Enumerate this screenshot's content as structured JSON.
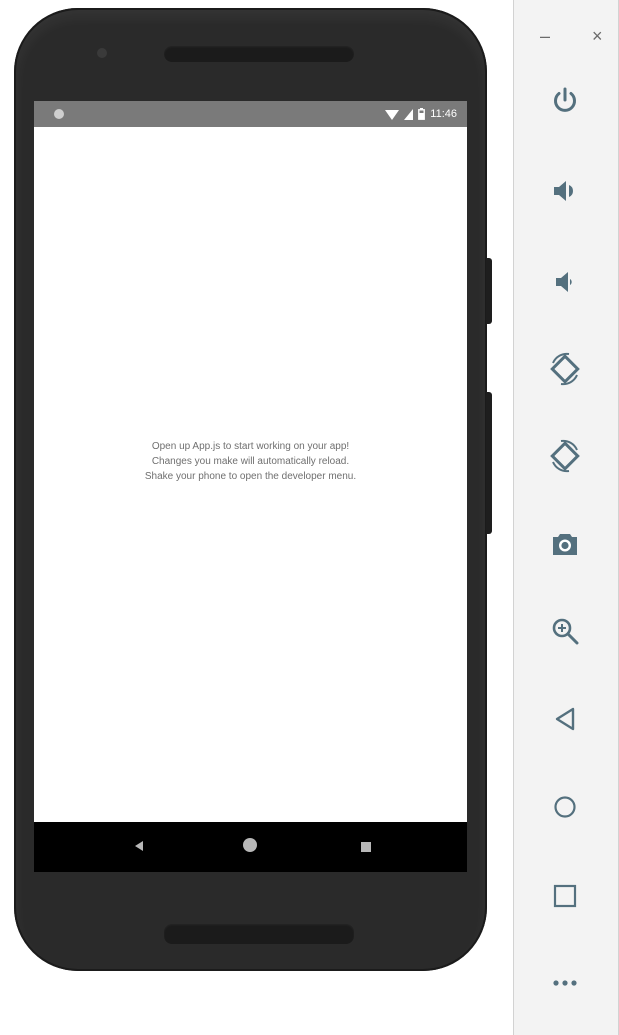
{
  "status_bar": {
    "time": "11:46"
  },
  "app": {
    "message_lines": [
      "Open up App.js to start working on your app!",
      "Changes you make will automatically reload.",
      "Shake your phone to open the developer menu."
    ]
  },
  "nav_bar": {
    "buttons": [
      "back-icon",
      "home-icon",
      "recents-icon"
    ]
  },
  "window_controls": {
    "minimize": "–",
    "close": "×"
  },
  "emulator_toolbar": {
    "tools": [
      "power-icon",
      "volume-up-icon",
      "volume-down-icon",
      "rotate-left-icon",
      "rotate-right-icon",
      "camera-icon",
      "zoom-icon",
      "back-icon",
      "home-icon",
      "overview-icon",
      "more-icon"
    ]
  },
  "colors": {
    "icon": "#54707e",
    "statusbar": "#7a7a7a",
    "phone_body": "#2a2a2a"
  }
}
